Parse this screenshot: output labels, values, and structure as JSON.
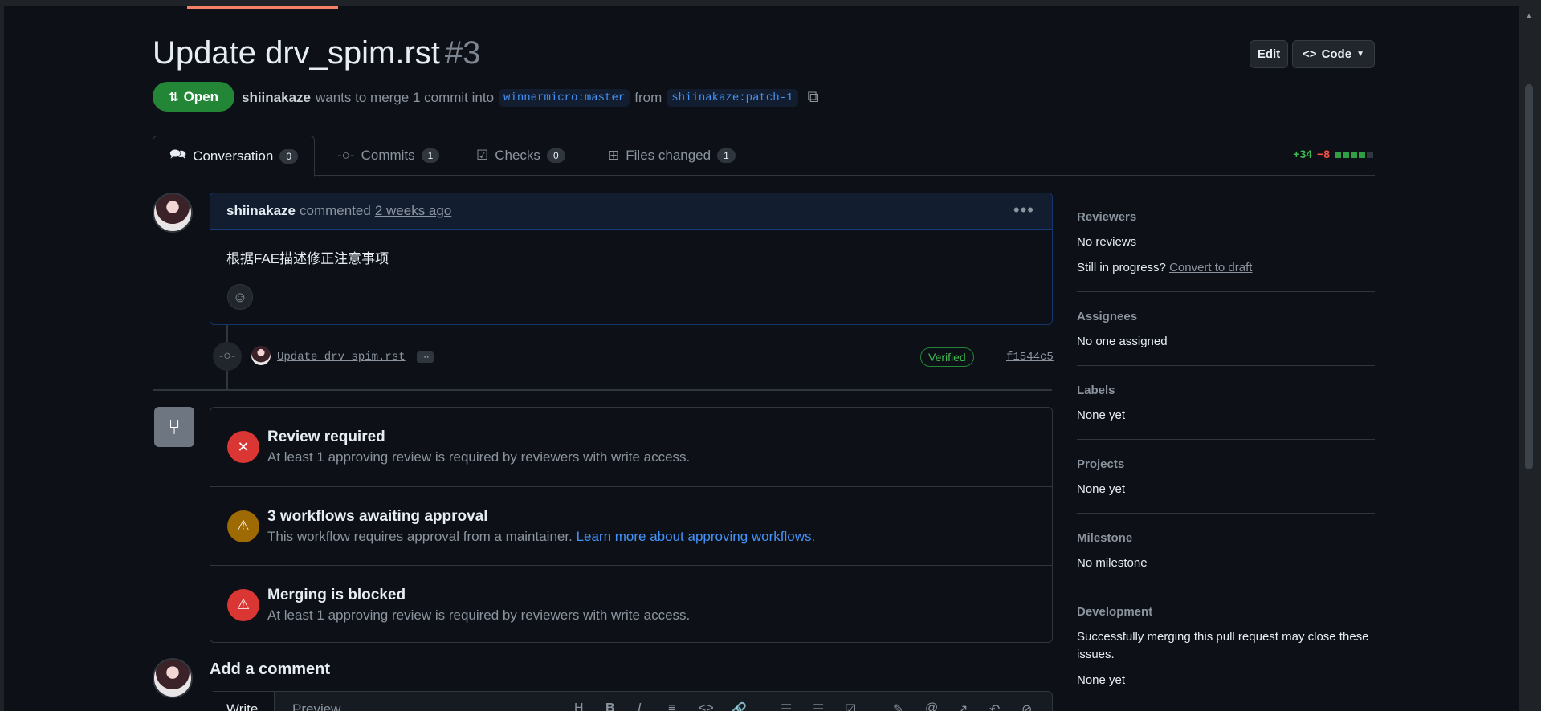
{
  "header": {
    "title": "Update drv_spim.rst",
    "number": "#3",
    "edit_label": "Edit",
    "code_label": "Code",
    "state_label": "Open",
    "author": "shiinakaze",
    "merge_text": "wants to merge 1 commit into",
    "base_branch": "winnermicro:master",
    "from_text": "from",
    "head_branch": "shiinakaze:patch-1"
  },
  "tabs": [
    {
      "label": "Conversation",
      "count": "0",
      "icon": "comment-discussion-icon"
    },
    {
      "label": "Commits",
      "count": "1",
      "icon": "git-commit-icon"
    },
    {
      "label": "Checks",
      "count": "0",
      "icon": "checklist-icon"
    },
    {
      "label": "Files changed",
      "count": "1",
      "icon": "file-diff-icon"
    }
  ],
  "diffstat": {
    "additions": "+34",
    "deletions": "−8",
    "blocks": [
      "#2ea043",
      "#2ea043",
      "#2ea043",
      "#2ea043",
      "#30363d"
    ]
  },
  "comment": {
    "author": "shiinakaze",
    "action": "commented",
    "time": "2 weeks ago",
    "body": "根据FAE描述修正注意事项"
  },
  "commit": {
    "message": "Update drv_spim.rst",
    "more": "···",
    "verified": "Verified",
    "sha": "f1544c5"
  },
  "checks": [
    {
      "title": "Review required",
      "desc": "At least 1 approving review is required by reviewers with write access.",
      "status": "failure",
      "color": "#da3633",
      "icon": "x-icon"
    },
    {
      "title": "3 workflows awaiting approval",
      "desc": "This workflow requires approval from a maintainer.",
      "link": "Learn more about approving workflows.",
      "status": "pending",
      "color": "#9e6a03",
      "icon": "alert-icon"
    },
    {
      "title": "Merging is blocked",
      "desc": "At least 1 approving review is required by reviewers with write access.",
      "status": "blocked",
      "color": "#da3633",
      "icon": "alert-icon"
    }
  ],
  "add_comment": {
    "title": "Add a comment",
    "write_tab": "Write",
    "preview_tab": "Preview"
  },
  "sidebar": {
    "reviewers": {
      "heading": "Reviewers",
      "value": "No reviews",
      "hint": "Still in progress?",
      "link": "Convert to draft"
    },
    "assignees": {
      "heading": "Assignees",
      "value": "No one assigned"
    },
    "labels": {
      "heading": "Labels",
      "value": "None yet"
    },
    "projects": {
      "heading": "Projects",
      "value": "None yet"
    },
    "milestone": {
      "heading": "Milestone",
      "value": "No milestone"
    },
    "development": {
      "heading": "Development",
      "value": "Successfully merging this pull request may close these issues.",
      "extra": "None yet"
    }
  }
}
